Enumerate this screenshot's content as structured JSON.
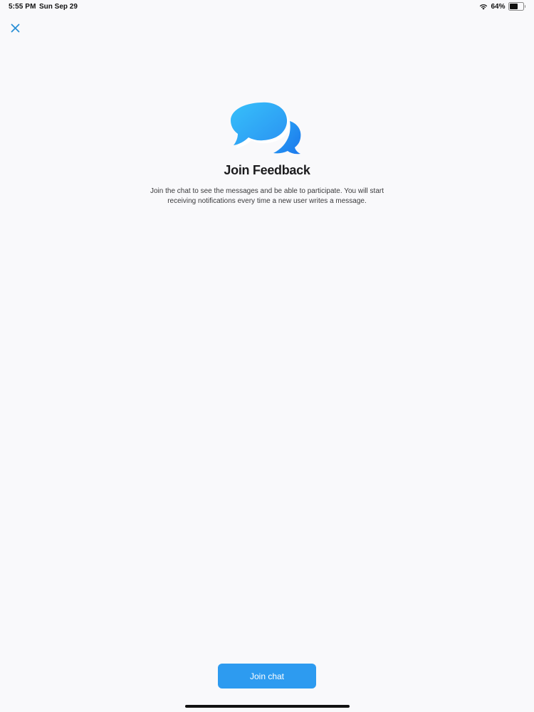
{
  "status_bar": {
    "time": "5:55 PM",
    "date": "Sun Sep 29",
    "battery_percent_label": "64%",
    "battery_level": 0.64
  },
  "icons": {
    "close": "close-icon",
    "hero": "chat-bubbles-icon",
    "wifi": "wifi-icon",
    "battery": "battery-icon"
  },
  "colors": {
    "accent": "#2d9bf0",
    "close_icon": "#2a8fd6",
    "bubble_light": "#3bb4f6",
    "bubble_dark": "#1f86f0",
    "background": "#f9f9fb"
  },
  "main": {
    "title": "Join Feedback",
    "description": "Join the chat to see the messages and be able to participate. You will start receiving notifications every time a new user writes a message."
  },
  "actions": {
    "join_label": "Join chat"
  }
}
